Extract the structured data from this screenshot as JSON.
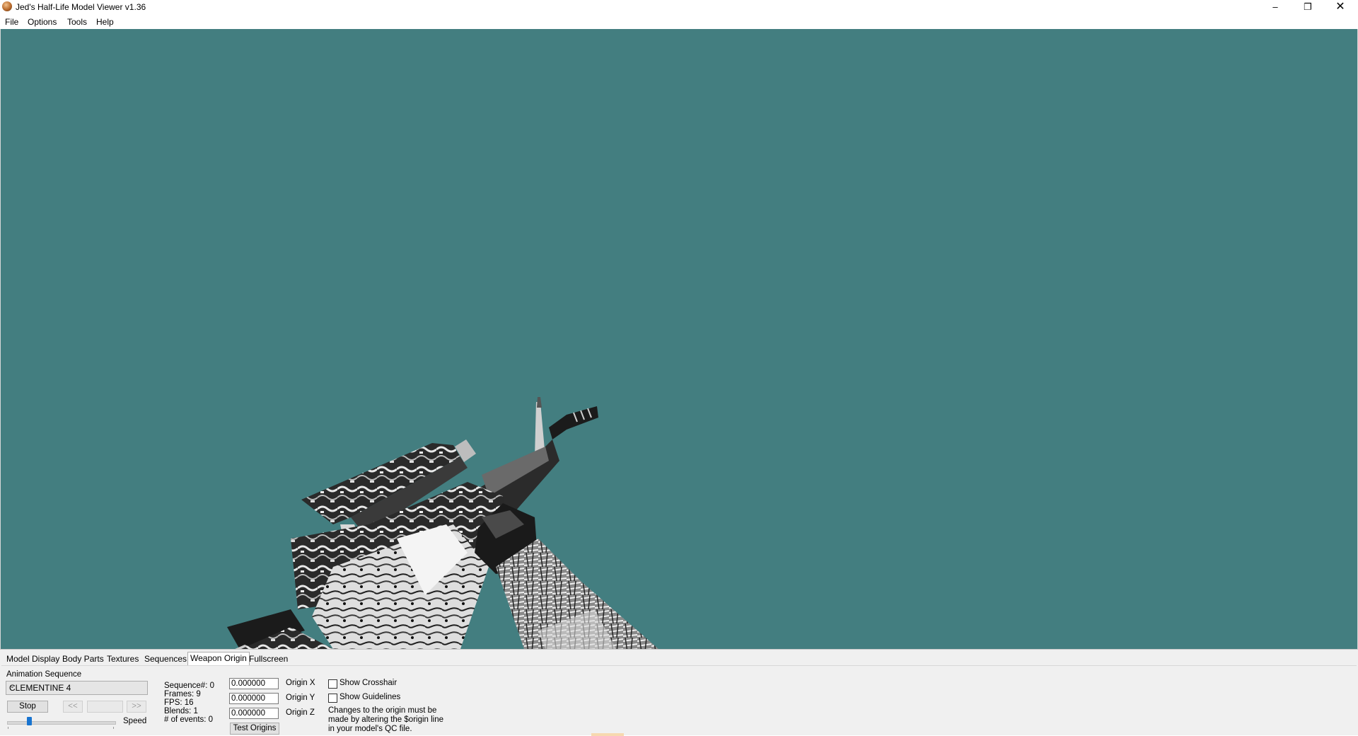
{
  "window": {
    "title": "Jed's Half-Life Model Viewer v1.36",
    "controls": {
      "minimize": "–",
      "maximize": "❐",
      "close": "✕"
    }
  },
  "menu": [
    "File",
    "Options",
    "Tools",
    "Help"
  ],
  "viewport": {
    "background": "#437e80"
  },
  "tabs": [
    "Model Display",
    "Body Parts",
    "Textures",
    "Sequences",
    "Weapon Origin",
    "Fullscreen"
  ],
  "active_tab": "Weapon Origin",
  "animation": {
    "label": "Animation Sequence",
    "selected": "CLEMENTINE 4",
    "stop_label": "Stop",
    "prev_label": "<<",
    "next_label": ">>",
    "speed_label": "Speed",
    "speed_fraction": 0.2
  },
  "sequence_info": {
    "sequence": "Sequence#: 0",
    "frames": "Frames: 9",
    "fps": "FPS: 16",
    "blends": "Blends: 1",
    "events": "# of events: 0"
  },
  "origin": {
    "x_value": "0.000000",
    "x_label": "Origin X",
    "y_value": "0.000000",
    "y_label": "Origin Y",
    "z_value": "0.000000",
    "z_label": "Origin Z",
    "test_label": "Test Origins"
  },
  "options": {
    "crosshair_label": "Show Crosshair",
    "crosshair_checked": false,
    "guidelines_label": "Show Guidelines",
    "guidelines_checked": false,
    "note_line1": "Changes to the origin must be",
    "note_line2": "made by altering the $origin line",
    "note_line3": "in your model's QC file."
  }
}
